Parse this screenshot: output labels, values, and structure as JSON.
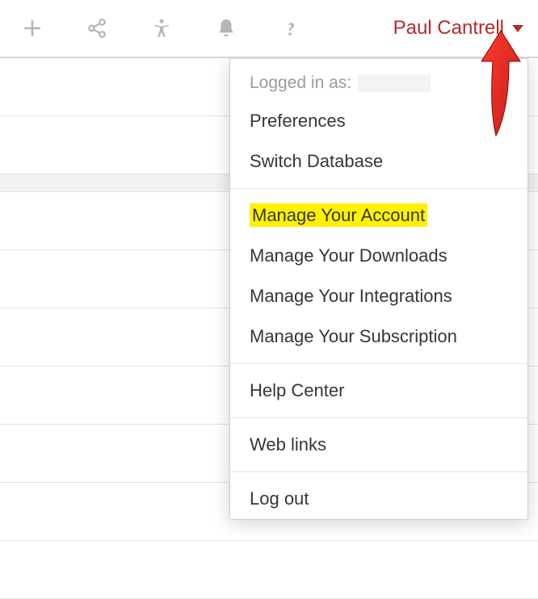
{
  "topbar": {
    "user_name": "Paul Cantrell"
  },
  "dropdown": {
    "logged_in_label": "Logged in as:",
    "items": [
      {
        "label": "Preferences",
        "highlight": false
      },
      {
        "label": "Switch Database",
        "highlight": false
      }
    ],
    "items2": [
      {
        "label": "Manage Your Account",
        "highlight": true
      },
      {
        "label": "Manage Your Downloads",
        "highlight": false
      },
      {
        "label": "Manage Your Integrations",
        "highlight": false
      },
      {
        "label": "Manage Your Subscription",
        "highlight": false
      }
    ],
    "items3": [
      {
        "label": "Help Center",
        "highlight": false
      }
    ],
    "items4": [
      {
        "label": "Web links",
        "highlight": false
      }
    ],
    "items5": [
      {
        "label": "Log out",
        "highlight": false
      }
    ]
  }
}
